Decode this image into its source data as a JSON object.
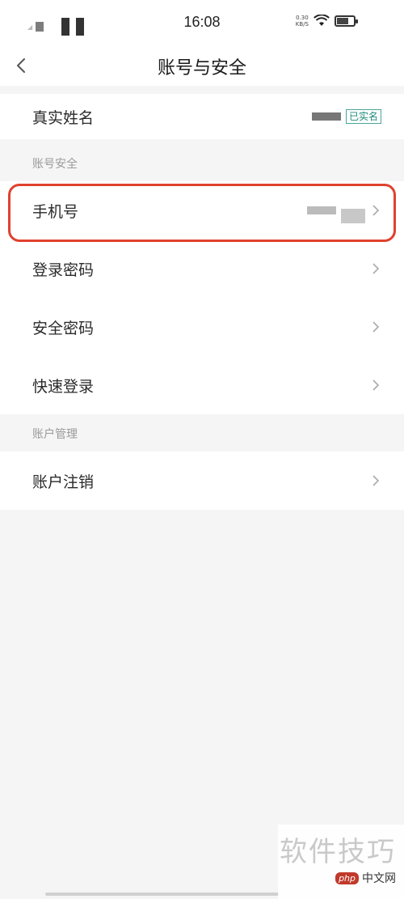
{
  "status_bar": {
    "time": "16:08",
    "net_speed": "0.30",
    "net_unit": "KB/S"
  },
  "navbar": {
    "title": "账号与安全"
  },
  "real_name": {
    "label": "真实姓名",
    "badge": "已实名"
  },
  "sections": {
    "account_security": "账号安全",
    "account_management": "账户管理"
  },
  "rows": {
    "phone": "手机号",
    "login_password": "登录密码",
    "security_password": "安全密码",
    "quick_login": "快速登录",
    "cancel_account": "账户注销"
  },
  "watermark": {
    "text": "软件技巧",
    "logo_badge": "php",
    "logo_text": "中文网"
  },
  "colors": {
    "highlight": "#e0412e",
    "badge": "#1d8a7a"
  }
}
